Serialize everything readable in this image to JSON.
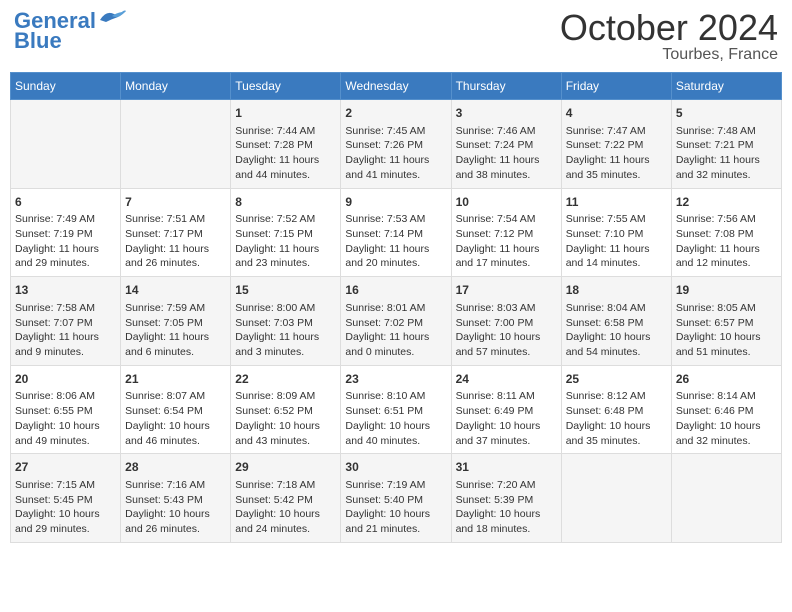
{
  "header": {
    "logo_line1": "General",
    "logo_line2": "Blue",
    "month": "October 2024",
    "location": "Tourbes, France"
  },
  "weekdays": [
    "Sunday",
    "Monday",
    "Tuesday",
    "Wednesday",
    "Thursday",
    "Friday",
    "Saturday"
  ],
  "weeks": [
    [
      {
        "day": "",
        "info": ""
      },
      {
        "day": "",
        "info": ""
      },
      {
        "day": "1",
        "info": "Sunrise: 7:44 AM\nSunset: 7:28 PM\nDaylight: 11 hours and 44 minutes."
      },
      {
        "day": "2",
        "info": "Sunrise: 7:45 AM\nSunset: 7:26 PM\nDaylight: 11 hours and 41 minutes."
      },
      {
        "day": "3",
        "info": "Sunrise: 7:46 AM\nSunset: 7:24 PM\nDaylight: 11 hours and 38 minutes."
      },
      {
        "day": "4",
        "info": "Sunrise: 7:47 AM\nSunset: 7:22 PM\nDaylight: 11 hours and 35 minutes."
      },
      {
        "day": "5",
        "info": "Sunrise: 7:48 AM\nSunset: 7:21 PM\nDaylight: 11 hours and 32 minutes."
      }
    ],
    [
      {
        "day": "6",
        "info": "Sunrise: 7:49 AM\nSunset: 7:19 PM\nDaylight: 11 hours and 29 minutes."
      },
      {
        "day": "7",
        "info": "Sunrise: 7:51 AM\nSunset: 7:17 PM\nDaylight: 11 hours and 26 minutes."
      },
      {
        "day": "8",
        "info": "Sunrise: 7:52 AM\nSunset: 7:15 PM\nDaylight: 11 hours and 23 minutes."
      },
      {
        "day": "9",
        "info": "Sunrise: 7:53 AM\nSunset: 7:14 PM\nDaylight: 11 hours and 20 minutes."
      },
      {
        "day": "10",
        "info": "Sunrise: 7:54 AM\nSunset: 7:12 PM\nDaylight: 11 hours and 17 minutes."
      },
      {
        "day": "11",
        "info": "Sunrise: 7:55 AM\nSunset: 7:10 PM\nDaylight: 11 hours and 14 minutes."
      },
      {
        "day": "12",
        "info": "Sunrise: 7:56 AM\nSunset: 7:08 PM\nDaylight: 11 hours and 12 minutes."
      }
    ],
    [
      {
        "day": "13",
        "info": "Sunrise: 7:58 AM\nSunset: 7:07 PM\nDaylight: 11 hours and 9 minutes."
      },
      {
        "day": "14",
        "info": "Sunrise: 7:59 AM\nSunset: 7:05 PM\nDaylight: 11 hours and 6 minutes."
      },
      {
        "day": "15",
        "info": "Sunrise: 8:00 AM\nSunset: 7:03 PM\nDaylight: 11 hours and 3 minutes."
      },
      {
        "day": "16",
        "info": "Sunrise: 8:01 AM\nSunset: 7:02 PM\nDaylight: 11 hours and 0 minutes."
      },
      {
        "day": "17",
        "info": "Sunrise: 8:03 AM\nSunset: 7:00 PM\nDaylight: 10 hours and 57 minutes."
      },
      {
        "day": "18",
        "info": "Sunrise: 8:04 AM\nSunset: 6:58 PM\nDaylight: 10 hours and 54 minutes."
      },
      {
        "day": "19",
        "info": "Sunrise: 8:05 AM\nSunset: 6:57 PM\nDaylight: 10 hours and 51 minutes."
      }
    ],
    [
      {
        "day": "20",
        "info": "Sunrise: 8:06 AM\nSunset: 6:55 PM\nDaylight: 10 hours and 49 minutes."
      },
      {
        "day": "21",
        "info": "Sunrise: 8:07 AM\nSunset: 6:54 PM\nDaylight: 10 hours and 46 minutes."
      },
      {
        "day": "22",
        "info": "Sunrise: 8:09 AM\nSunset: 6:52 PM\nDaylight: 10 hours and 43 minutes."
      },
      {
        "day": "23",
        "info": "Sunrise: 8:10 AM\nSunset: 6:51 PM\nDaylight: 10 hours and 40 minutes."
      },
      {
        "day": "24",
        "info": "Sunrise: 8:11 AM\nSunset: 6:49 PM\nDaylight: 10 hours and 37 minutes."
      },
      {
        "day": "25",
        "info": "Sunrise: 8:12 AM\nSunset: 6:48 PM\nDaylight: 10 hours and 35 minutes."
      },
      {
        "day": "26",
        "info": "Sunrise: 8:14 AM\nSunset: 6:46 PM\nDaylight: 10 hours and 32 minutes."
      }
    ],
    [
      {
        "day": "27",
        "info": "Sunrise: 7:15 AM\nSunset: 5:45 PM\nDaylight: 10 hours and 29 minutes."
      },
      {
        "day": "28",
        "info": "Sunrise: 7:16 AM\nSunset: 5:43 PM\nDaylight: 10 hours and 26 minutes."
      },
      {
        "day": "29",
        "info": "Sunrise: 7:18 AM\nSunset: 5:42 PM\nDaylight: 10 hours and 24 minutes."
      },
      {
        "day": "30",
        "info": "Sunrise: 7:19 AM\nSunset: 5:40 PM\nDaylight: 10 hours and 21 minutes."
      },
      {
        "day": "31",
        "info": "Sunrise: 7:20 AM\nSunset: 5:39 PM\nDaylight: 10 hours and 18 minutes."
      },
      {
        "day": "",
        "info": ""
      },
      {
        "day": "",
        "info": ""
      }
    ]
  ]
}
